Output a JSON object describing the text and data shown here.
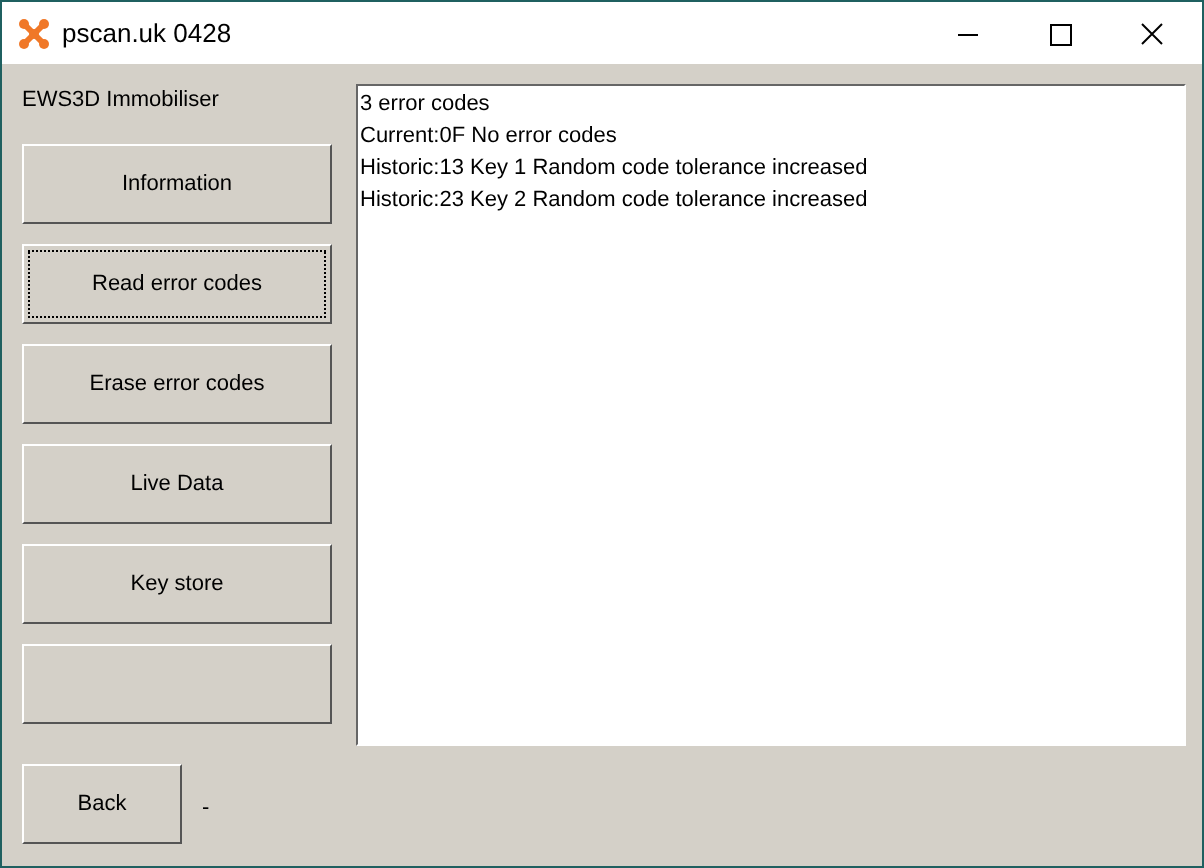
{
  "window": {
    "title": "pscan.uk 0428"
  },
  "panel_title": "EWS3D Immobiliser",
  "buttons": [
    {
      "label": "Information",
      "focused": false
    },
    {
      "label": "Read error codes",
      "focused": true
    },
    {
      "label": "Erase error codes",
      "focused": false
    },
    {
      "label": "Live Data",
      "focused": false
    },
    {
      "label": "Key store",
      "focused": false
    },
    {
      "focused": false
    }
  ],
  "output_lines": [
    "3 error codes",
    "Current:0F No error codes",
    "Historic:13 Key 1 Random code tolerance increased",
    "Historic:23 Key 2 Random code tolerance increased"
  ],
  "back_button": {
    "label": "Back"
  },
  "status_text": "-"
}
